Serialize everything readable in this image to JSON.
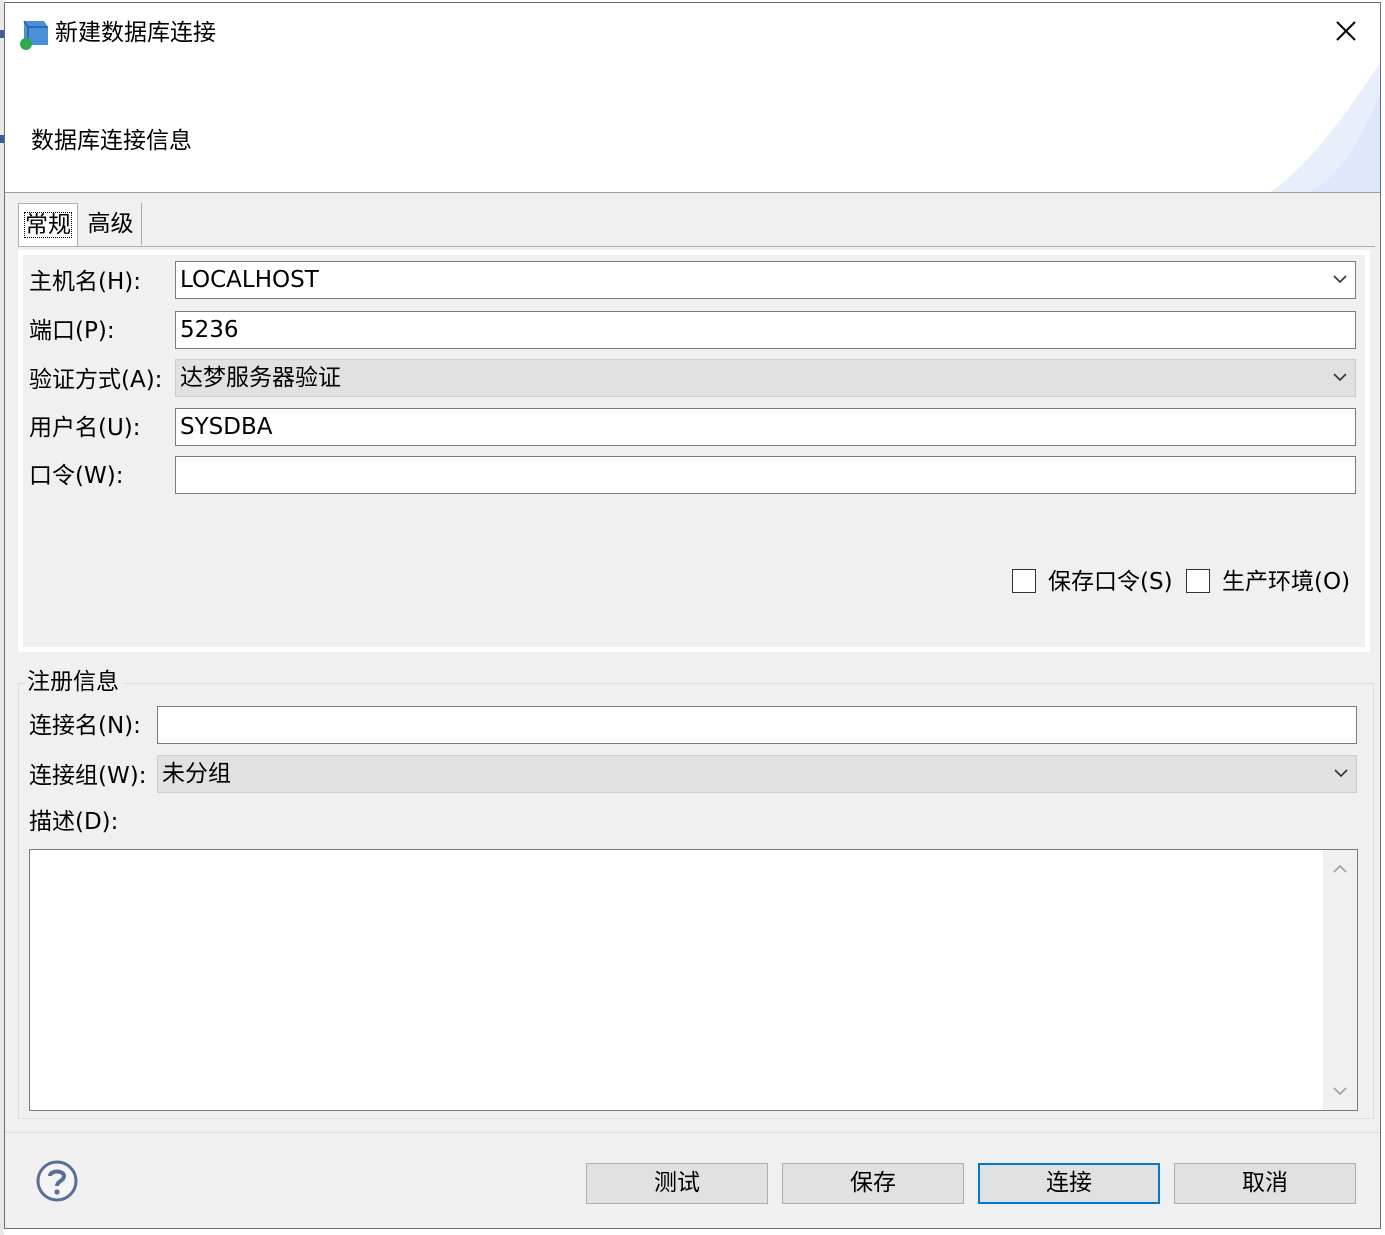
{
  "window": {
    "title": "新建数据库连接",
    "banner_title": "数据库连接信息"
  },
  "tabs": [
    {
      "label": "常规",
      "selected": true
    },
    {
      "label": "高级",
      "selected": false
    }
  ],
  "form": {
    "host": {
      "label": "主机名(H):",
      "mnemonic": "H",
      "value": "LOCALHOST"
    },
    "port": {
      "label": "端口(P):",
      "mnemonic": "P",
      "value": "5236"
    },
    "auth": {
      "label": "验证方式(A):",
      "mnemonic": "A",
      "value": "达梦服务器验证"
    },
    "user": {
      "label": "用户名(U):",
      "mnemonic": "U",
      "value": "SYSDBA"
    },
    "password": {
      "label": "口令(W):",
      "mnemonic": "W",
      "value": ""
    },
    "save_password": {
      "label": "保存口令(S)",
      "mnemonic": "S",
      "checked": false
    },
    "production": {
      "label": "生产环境(O)",
      "mnemonic": "O",
      "checked": false
    }
  },
  "registration": {
    "title": "注册信息",
    "conn_name": {
      "label": "连接名(N):",
      "mnemonic": "N",
      "value": ""
    },
    "conn_group": {
      "label": "连接组(W):",
      "mnemonic": "W",
      "value": "未分组"
    },
    "description": {
      "label": "描述(D):",
      "mnemonic": "D",
      "value": ""
    }
  },
  "buttons": {
    "test": "测试",
    "save": "保存",
    "connect": "连接",
    "cancel": "取消"
  },
  "icons": {
    "app": "database-connection-icon",
    "close": "close-icon",
    "help": "help-icon",
    "dropdown": "chevron-down-icon"
  },
  "colors": {
    "default_button_border": "#0078d7",
    "dialog_background": "#f0f0f0"
  }
}
